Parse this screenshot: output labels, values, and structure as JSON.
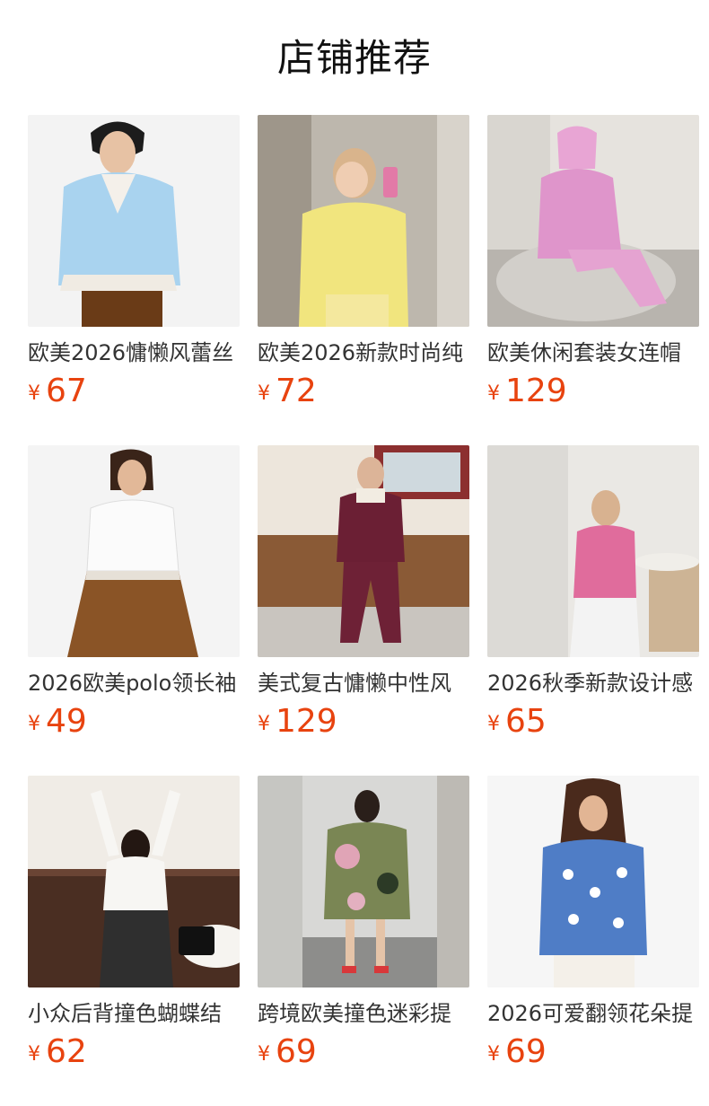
{
  "section_title": "店铺推荐",
  "currency_symbol": "¥",
  "accent_color": "#e8430f",
  "products": [
    {
      "name": "欧美2026慵懒风蕾丝",
      "price": "67"
    },
    {
      "name": "欧美2026新款时尚纯",
      "price": "72"
    },
    {
      "name": "欧美休闲套装女连帽",
      "price": "129"
    },
    {
      "name": "2026欧美polo领长袖",
      "price": "49"
    },
    {
      "name": "美式复古慵懒中性风",
      "price": "129"
    },
    {
      "name": "2026秋季新款设计感",
      "price": "65"
    },
    {
      "name": "小众后背撞色蝴蝶结",
      "price": "62"
    },
    {
      "name": "跨境欧美撞色迷彩提",
      "price": "69"
    },
    {
      "name": "2026可爱翻领花朵提",
      "price": "69"
    }
  ]
}
